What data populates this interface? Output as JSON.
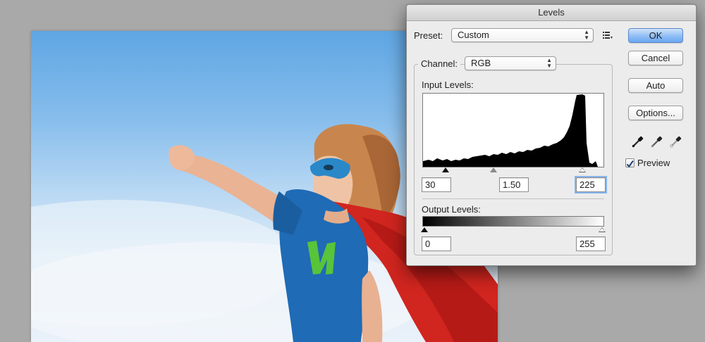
{
  "dialog": {
    "title": "Levels",
    "preset_label": "Preset:",
    "preset_value": "Custom",
    "preset_menu_icon": "list-options-icon",
    "channel_label": "Channel:",
    "channel_value": "RGB",
    "input_levels_label": "Input Levels:",
    "input_black": "30",
    "input_gamma": "1.50",
    "input_white": "225",
    "output_levels_label": "Output Levels:",
    "output_black": "0",
    "output_white": "255",
    "buttons": {
      "ok": "OK",
      "cancel": "Cancel",
      "auto": "Auto",
      "options": "Options..."
    },
    "eyedroppers": [
      "black-eyedropper-icon",
      "gray-eyedropper-icon",
      "white-eyedropper-icon"
    ],
    "preview_label": "Preview",
    "preview_checked": true,
    "histogram_icon": "histogram"
  },
  "colors": {
    "default_button": "#6aa6f0",
    "sky": "#86bdec",
    "cape_red": "#d1251f",
    "shirt_blue": "#1f6bb5",
    "mask_blue": "#2a88c8"
  }
}
